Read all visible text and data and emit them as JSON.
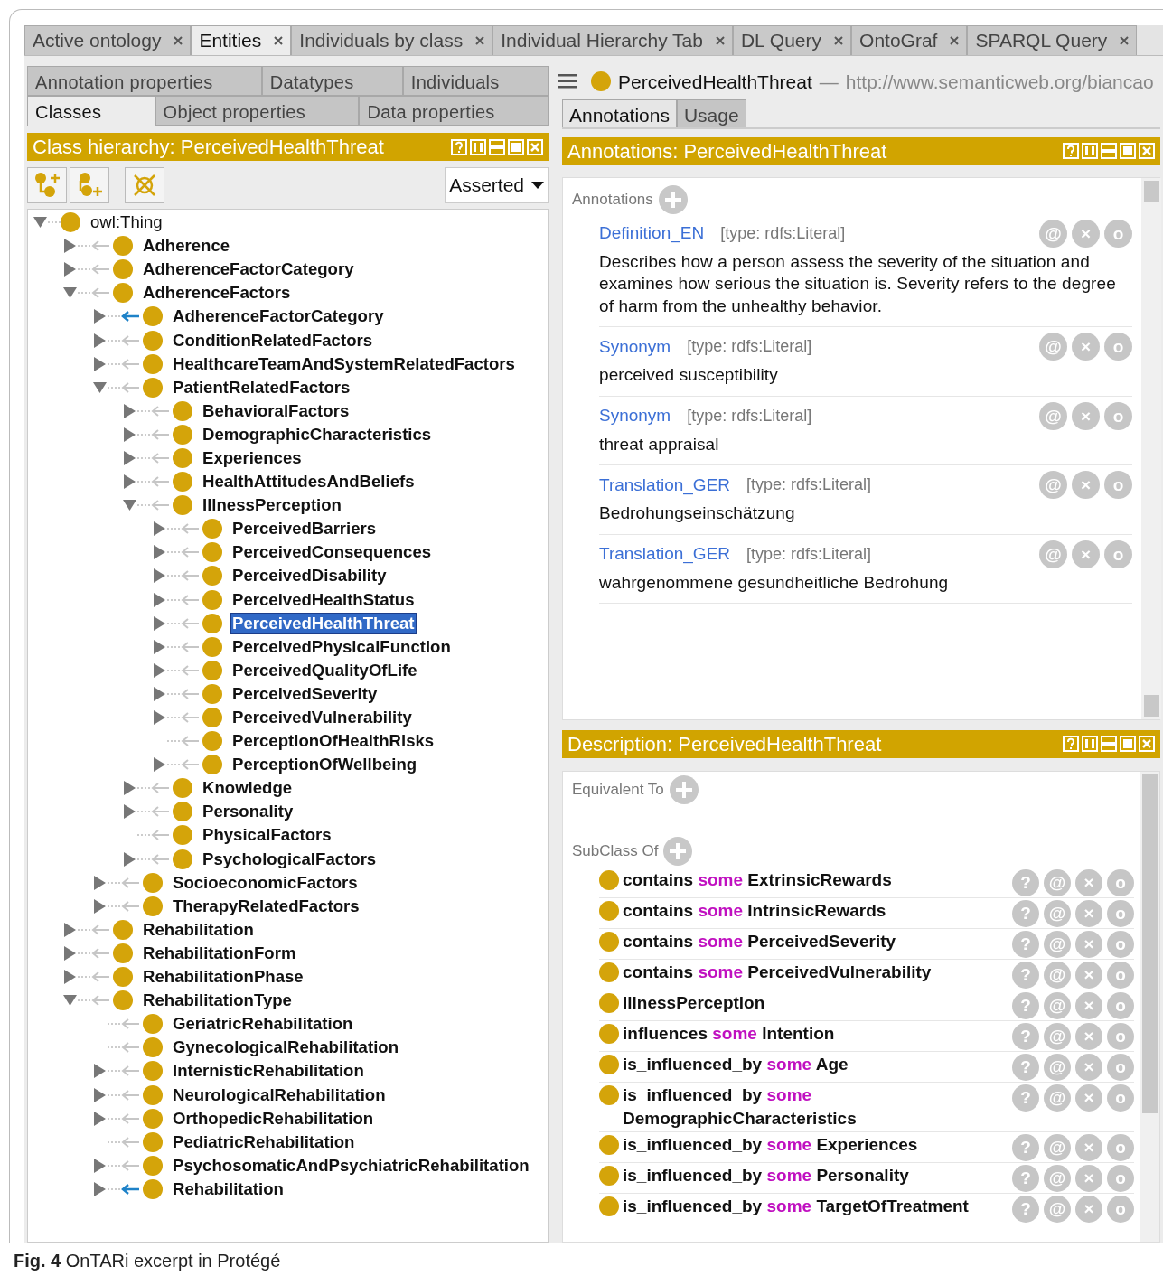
{
  "top_tabs": [
    {
      "label": "Active ontology",
      "selected": false
    },
    {
      "label": "Entities",
      "selected": true
    },
    {
      "label": "Individuals by class",
      "selected": false
    },
    {
      "label": "Individual Hierarchy Tab",
      "selected": false
    },
    {
      "label": "DL Query",
      "selected": false
    },
    {
      "label": "OntoGraf",
      "selected": false
    },
    {
      "label": "SPARQL Query",
      "selected": false
    }
  ],
  "entity_tab_rows": [
    {
      "tabs": [
        {
          "label": "Annotation properties",
          "selected": false
        },
        {
          "label": "Datatypes",
          "selected": false
        },
        {
          "label": "Individuals",
          "selected": false
        }
      ]
    },
    {
      "tabs": [
        {
          "label": "Classes",
          "selected": true
        },
        {
          "label": "Object properties",
          "selected": false
        },
        {
          "label": "Data properties",
          "selected": false
        }
      ]
    }
  ],
  "class_hierarchy": {
    "title": "Class hierarchy: PerceivedHealthThreat",
    "mode": "Asserted",
    "tree": [
      {
        "label": "owl:Thing",
        "expanded": true,
        "selected": false,
        "children": [
          {
            "label": "Adherence",
            "expanded": false,
            "selected": false,
            "highlighted": false
          },
          {
            "label": "AdherenceFactorCategory",
            "expanded": false,
            "selected": false,
            "highlighted": false
          },
          {
            "label": "AdherenceFactors",
            "expanded": true,
            "selected": false,
            "highlighted": false,
            "children": [
              {
                "label": "AdherenceFactorCategory",
                "expanded": false,
                "selected": false,
                "highlighted": true
              },
              {
                "label": "ConditionRelatedFactors",
                "expanded": false,
                "selected": false,
                "highlighted": false
              },
              {
                "label": "HealthcareTeamAndSystemRelatedFactors",
                "expanded": false,
                "selected": false,
                "highlighted": false
              },
              {
                "label": "PatientRelatedFactors",
                "expanded": true,
                "selected": false,
                "highlighted": false,
                "children": [
                  {
                    "label": "BehavioralFactors",
                    "expanded": false,
                    "selected": false,
                    "highlighted": false
                  },
                  {
                    "label": "DemographicCharacteristics",
                    "expanded": false,
                    "selected": false,
                    "highlighted": false
                  },
                  {
                    "label": "Experiences",
                    "expanded": false,
                    "selected": false,
                    "highlighted": false
                  },
                  {
                    "label": "HealthAttitudesAndBeliefs",
                    "expanded": false,
                    "selected": false,
                    "highlighted": false
                  },
                  {
                    "label": "IllnessPerception",
                    "expanded": true,
                    "selected": false,
                    "highlighted": false,
                    "children": [
                      {
                        "label": "PerceivedBarriers",
                        "expanded": false,
                        "selected": false,
                        "highlighted": false
                      },
                      {
                        "label": "PerceivedConsequences",
                        "expanded": false,
                        "selected": false,
                        "highlighted": false
                      },
                      {
                        "label": "PerceivedDisability",
                        "expanded": false,
                        "selected": false,
                        "highlighted": false
                      },
                      {
                        "label": "PerceivedHealthStatus",
                        "expanded": false,
                        "selected": false,
                        "highlighted": false
                      },
                      {
                        "label": "PerceivedHealthThreat",
                        "expanded": false,
                        "selected": true,
                        "highlighted": false
                      },
                      {
                        "label": "PerceivedPhysicalFunction",
                        "expanded": false,
                        "selected": false,
                        "highlighted": false
                      },
                      {
                        "label": "PerceivedQualityOfLife",
                        "expanded": false,
                        "selected": false,
                        "highlighted": false
                      },
                      {
                        "label": "PerceivedSeverity",
                        "expanded": false,
                        "selected": false,
                        "highlighted": false
                      },
                      {
                        "label": "PerceivedVulnerability",
                        "expanded": false,
                        "selected": false,
                        "highlighted": false
                      },
                      {
                        "label": "PerceptionOfHealthRisks",
                        "selected": false,
                        "highlighted": false
                      },
                      {
                        "label": "PerceptionOfWellbeing",
                        "expanded": false,
                        "selected": false,
                        "highlighted": false
                      }
                    ]
                  },
                  {
                    "label": "Knowledge",
                    "expanded": false,
                    "selected": false,
                    "highlighted": false
                  },
                  {
                    "label": "Personality",
                    "expanded": false,
                    "selected": false,
                    "highlighted": false
                  },
                  {
                    "label": "PhysicalFactors",
                    "selected": false,
                    "highlighted": false
                  },
                  {
                    "label": "PsychologicalFactors",
                    "expanded": false,
                    "selected": false,
                    "highlighted": false
                  }
                ]
              },
              {
                "label": "SocioeconomicFactors",
                "expanded": false,
                "selected": false,
                "highlighted": false
              },
              {
                "label": "TherapyRelatedFactors",
                "expanded": false,
                "selected": false,
                "highlighted": false
              }
            ]
          },
          {
            "label": "Rehabilitation",
            "expanded": false,
            "selected": false,
            "highlighted": false
          },
          {
            "label": "RehabilitationForm",
            "expanded": false,
            "selected": false,
            "highlighted": false
          },
          {
            "label": "RehabilitationPhase",
            "expanded": false,
            "selected": false,
            "highlighted": false
          },
          {
            "label": "RehabilitationType",
            "expanded": true,
            "selected": false,
            "highlighted": false,
            "children": [
              {
                "label": "GeriatricRehabilitation",
                "selected": false,
                "highlighted": false
              },
              {
                "label": "GynecologicalRehabilitation",
                "selected": false,
                "highlighted": false
              },
              {
                "label": "InternisticRehabilitation",
                "expanded": false,
                "selected": false,
                "highlighted": false
              },
              {
                "label": "NeurologicalRehabilitation",
                "expanded": false,
                "selected": false,
                "highlighted": false
              },
              {
                "label": "OrthopedicRehabilitation",
                "expanded": false,
                "selected": false,
                "highlighted": false
              },
              {
                "label": "PediatricRehabilitation",
                "selected": false,
                "highlighted": false
              },
              {
                "label": "PsychosomaticAndPsychiatricRehabilitation",
                "expanded": false,
                "selected": false,
                "highlighted": false
              },
              {
                "label": "Rehabilitation",
                "expanded": false,
                "selected": false,
                "highlighted": true
              }
            ]
          }
        ]
      }
    ]
  },
  "entity_header": {
    "name": "PerceivedHealthThreat",
    "separator": "—",
    "iri": "http://www.semanticweb.org/biancao"
  },
  "detail_tabs": [
    {
      "label": "Annotations",
      "selected": true
    },
    {
      "label": "Usage",
      "selected": false
    }
  ],
  "annotations_panel": {
    "title": "Annotations: PerceivedHealthThreat",
    "section_label": "Annotations",
    "items": [
      {
        "property": "Definition_EN",
        "type": "[type: rdfs:Literal]",
        "value": "Describes how a person assess the severity of the situation and examines how serious the situation is. Severity refers to the degree of harm from the unhealthy behavior.",
        "actions": [
          "@",
          "×",
          "o"
        ]
      },
      {
        "property": "Synonym",
        "type": "[type: rdfs:Literal]",
        "value": "perceived susceptibility",
        "actions": [
          "@",
          "×",
          "o"
        ]
      },
      {
        "property": "Synonym",
        "type": "[type: rdfs:Literal]",
        "value": "threat appraisal",
        "actions": [
          "@",
          "×",
          "o"
        ]
      },
      {
        "property": "Translation_GER",
        "type": "[type: rdfs:Literal]",
        "value": "Bedrohungseinschätzung",
        "actions": [
          "@",
          "×",
          "o"
        ]
      },
      {
        "property": "Translation_GER",
        "type": "[type: rdfs:Literal]",
        "value": "wahrgenommene gesundheitliche Bedrohung",
        "actions": [
          "@",
          "×",
          "o"
        ]
      }
    ]
  },
  "description_panel": {
    "title": "Description: PerceivedHealthThreat",
    "sections": [
      {
        "label": "Equivalent To"
      },
      {
        "label": "SubClass Of",
        "items": [
          {
            "property": "contains",
            "quantifier": "some",
            "filler": "ExtrinsicRewards",
            "actions": [
              "?",
              "@",
              "×",
              "o"
            ]
          },
          {
            "property": "contains",
            "quantifier": "some",
            "filler": "IntrinsicRewards",
            "actions": [
              "?",
              "@",
              "×",
              "o"
            ]
          },
          {
            "property": "contains",
            "quantifier": "some",
            "filler": "PerceivedSeverity",
            "actions": [
              "?",
              "@",
              "×",
              "o"
            ]
          },
          {
            "property": "contains",
            "quantifier": "some",
            "filler": "PerceivedVulnerability",
            "actions": [
              "?",
              "@",
              "×",
              "o"
            ]
          },
          {
            "filler": "IllnessPerception",
            "actions": [
              "?",
              "@",
              "×",
              "o"
            ]
          },
          {
            "property": "influences",
            "quantifier": "some",
            "filler": "Intention",
            "actions": [
              "?",
              "@",
              "×",
              "o"
            ]
          },
          {
            "property": "is_influenced_by",
            "quantifier": "some",
            "filler": "Age",
            "actions": [
              "?",
              "@",
              "×",
              "o"
            ]
          },
          {
            "property": "is_influenced_by",
            "quantifier": "some",
            "filler": "DemographicCharacteristics",
            "actions": [
              "?",
              "@",
              "×",
              "o"
            ]
          },
          {
            "property": "is_influenced_by",
            "quantifier": "some",
            "filler": "Experiences",
            "actions": [
              "?",
              "@",
              "×",
              "o"
            ]
          },
          {
            "property": "is_influenced_by",
            "quantifier": "some",
            "filler": "Personality",
            "actions": [
              "?",
              "@",
              "×",
              "o"
            ]
          },
          {
            "property": "is_influenced_by",
            "quantifier": "some",
            "filler": "TargetOfTreatment",
            "actions": [
              "?",
              "@",
              "×",
              "o"
            ]
          }
        ]
      }
    ]
  },
  "caption": "**Fig. 4**  OnTARi excerpt in Protégé"
}
